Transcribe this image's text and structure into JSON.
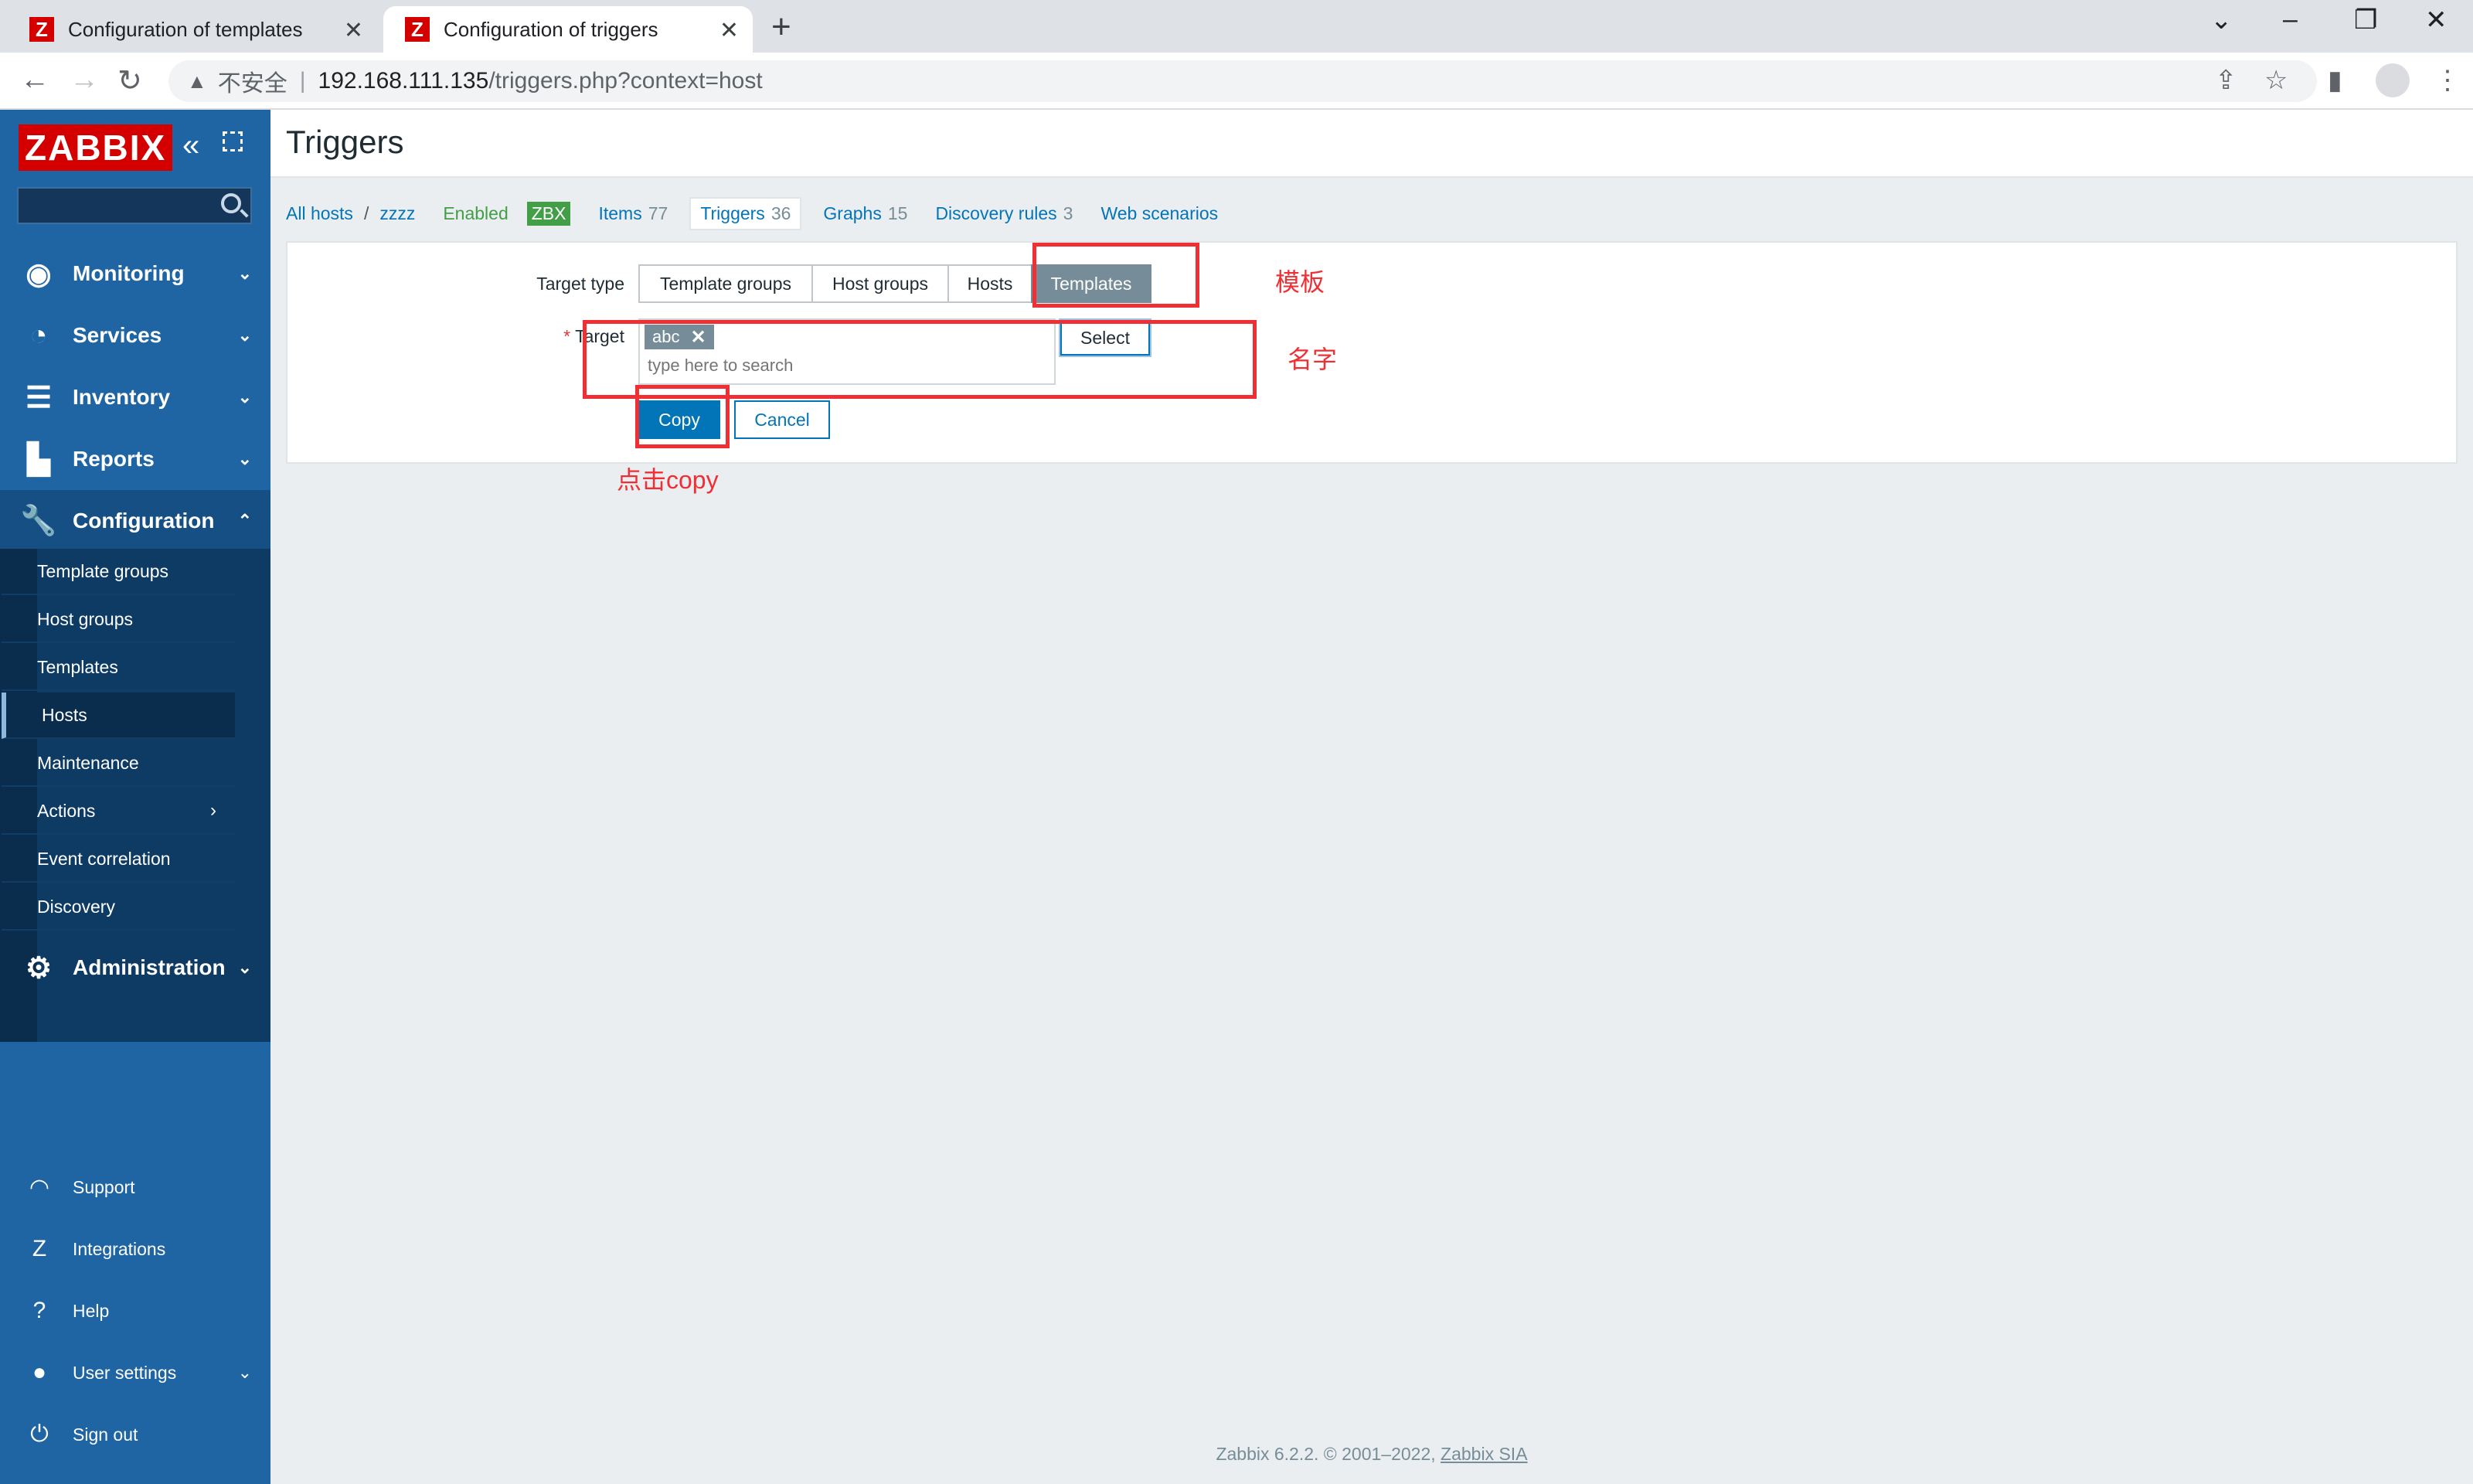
{
  "browser": {
    "tabs": [
      {
        "title": "Configuration of templates",
        "favicon": "Z"
      },
      {
        "title": "Configuration of triggers",
        "favicon": "Z"
      }
    ],
    "address": {
      "security": "不安全",
      "host": "192.168.111.135",
      "path": "/triggers.php?context=host"
    }
  },
  "sidebar": {
    "logo": "ZABBIX",
    "search_placeholder": "",
    "menu": [
      {
        "label": "Monitoring",
        "icon": "eye-icon"
      },
      {
        "label": "Services",
        "icon": "timer-icon"
      },
      {
        "label": "Inventory",
        "icon": "list-icon"
      },
      {
        "label": "Reports",
        "icon": "bar-chart-icon"
      },
      {
        "label": "Configuration",
        "icon": "wrench-icon"
      },
      {
        "label": "Administration",
        "icon": "gear-icon"
      }
    ],
    "config_items": [
      "Template groups",
      "Host groups",
      "Templates",
      "Hosts",
      "Maintenance",
      "Actions",
      "Event correlation",
      "Discovery"
    ],
    "footer_items": [
      "Support",
      "Integrations",
      "Help",
      "User settings",
      "Sign out"
    ]
  },
  "page": {
    "title": "Triggers"
  },
  "breadcrumbs": {
    "all_hosts": "All hosts",
    "separator": "/",
    "host": "zzzz",
    "status": "Enabled",
    "zbx": "ZBX",
    "tabs": [
      {
        "label": "Items",
        "count": "77"
      },
      {
        "label": "Triggers",
        "count": "36"
      },
      {
        "label": "Graphs",
        "count": "15"
      },
      {
        "label": "Discovery rules",
        "count": "3"
      },
      {
        "label": "Web scenarios",
        "count": ""
      }
    ]
  },
  "form": {
    "target_type_label": "Target type",
    "target_types": [
      "Template groups",
      "Host groups",
      "Hosts",
      "Templates"
    ],
    "selected_target_type": "Templates",
    "target_label": "Target",
    "required_mark": "*",
    "target_chip": "abc",
    "target_placeholder": "type here to search",
    "select_label": "Select",
    "copy_label": "Copy",
    "cancel_label": "Cancel"
  },
  "annotations": {
    "template": "模板",
    "name": "名字",
    "click_copy": "点击copy"
  },
  "footer": {
    "text": "Zabbix 6.2.2. © 2001–2022, ",
    "link": "Zabbix SIA"
  },
  "colors": {
    "sidebar": "#1f65a3",
    "accent": "#0275b8",
    "annotation": "#ef2f33"
  }
}
